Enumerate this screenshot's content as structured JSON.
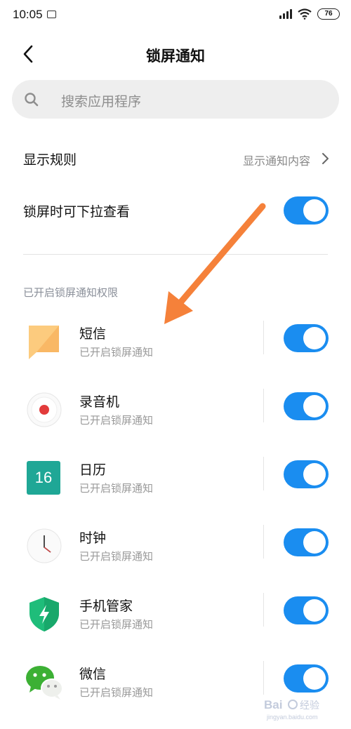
{
  "status_bar": {
    "time": "10:05",
    "battery": "76"
  },
  "header": {
    "title": "锁屏通知"
  },
  "search": {
    "placeholder": "搜索应用程序"
  },
  "settings": {
    "display_rule_label": "显示规则",
    "display_rule_value": "显示通知内容",
    "pulldown_label": "锁屏时可下拉查看",
    "pulldown_enabled": true
  },
  "section": {
    "title": "已开启锁屏通知权限"
  },
  "apps": [
    {
      "name": "短信",
      "status": "已开启锁屏通知",
      "icon": "sms-icon",
      "enabled": true
    },
    {
      "name": "录音机",
      "status": "已开启锁屏通知",
      "icon": "recorder-icon",
      "enabled": true
    },
    {
      "name": "日历",
      "status": "已开启锁屏通知",
      "icon": "calendar-icon",
      "calendar_day": "16",
      "enabled": true
    },
    {
      "name": "时钟",
      "status": "已开启锁屏通知",
      "icon": "clock-icon",
      "enabled": true
    },
    {
      "name": "手机管家",
      "status": "已开启锁屏通知",
      "icon": "security-icon",
      "enabled": true
    },
    {
      "name": "微信",
      "status": "已开启锁屏通知",
      "icon": "wechat-icon",
      "enabled": true
    }
  ],
  "colors": {
    "toggle_on": "#1a8df0",
    "arrow": "#f5813a"
  }
}
